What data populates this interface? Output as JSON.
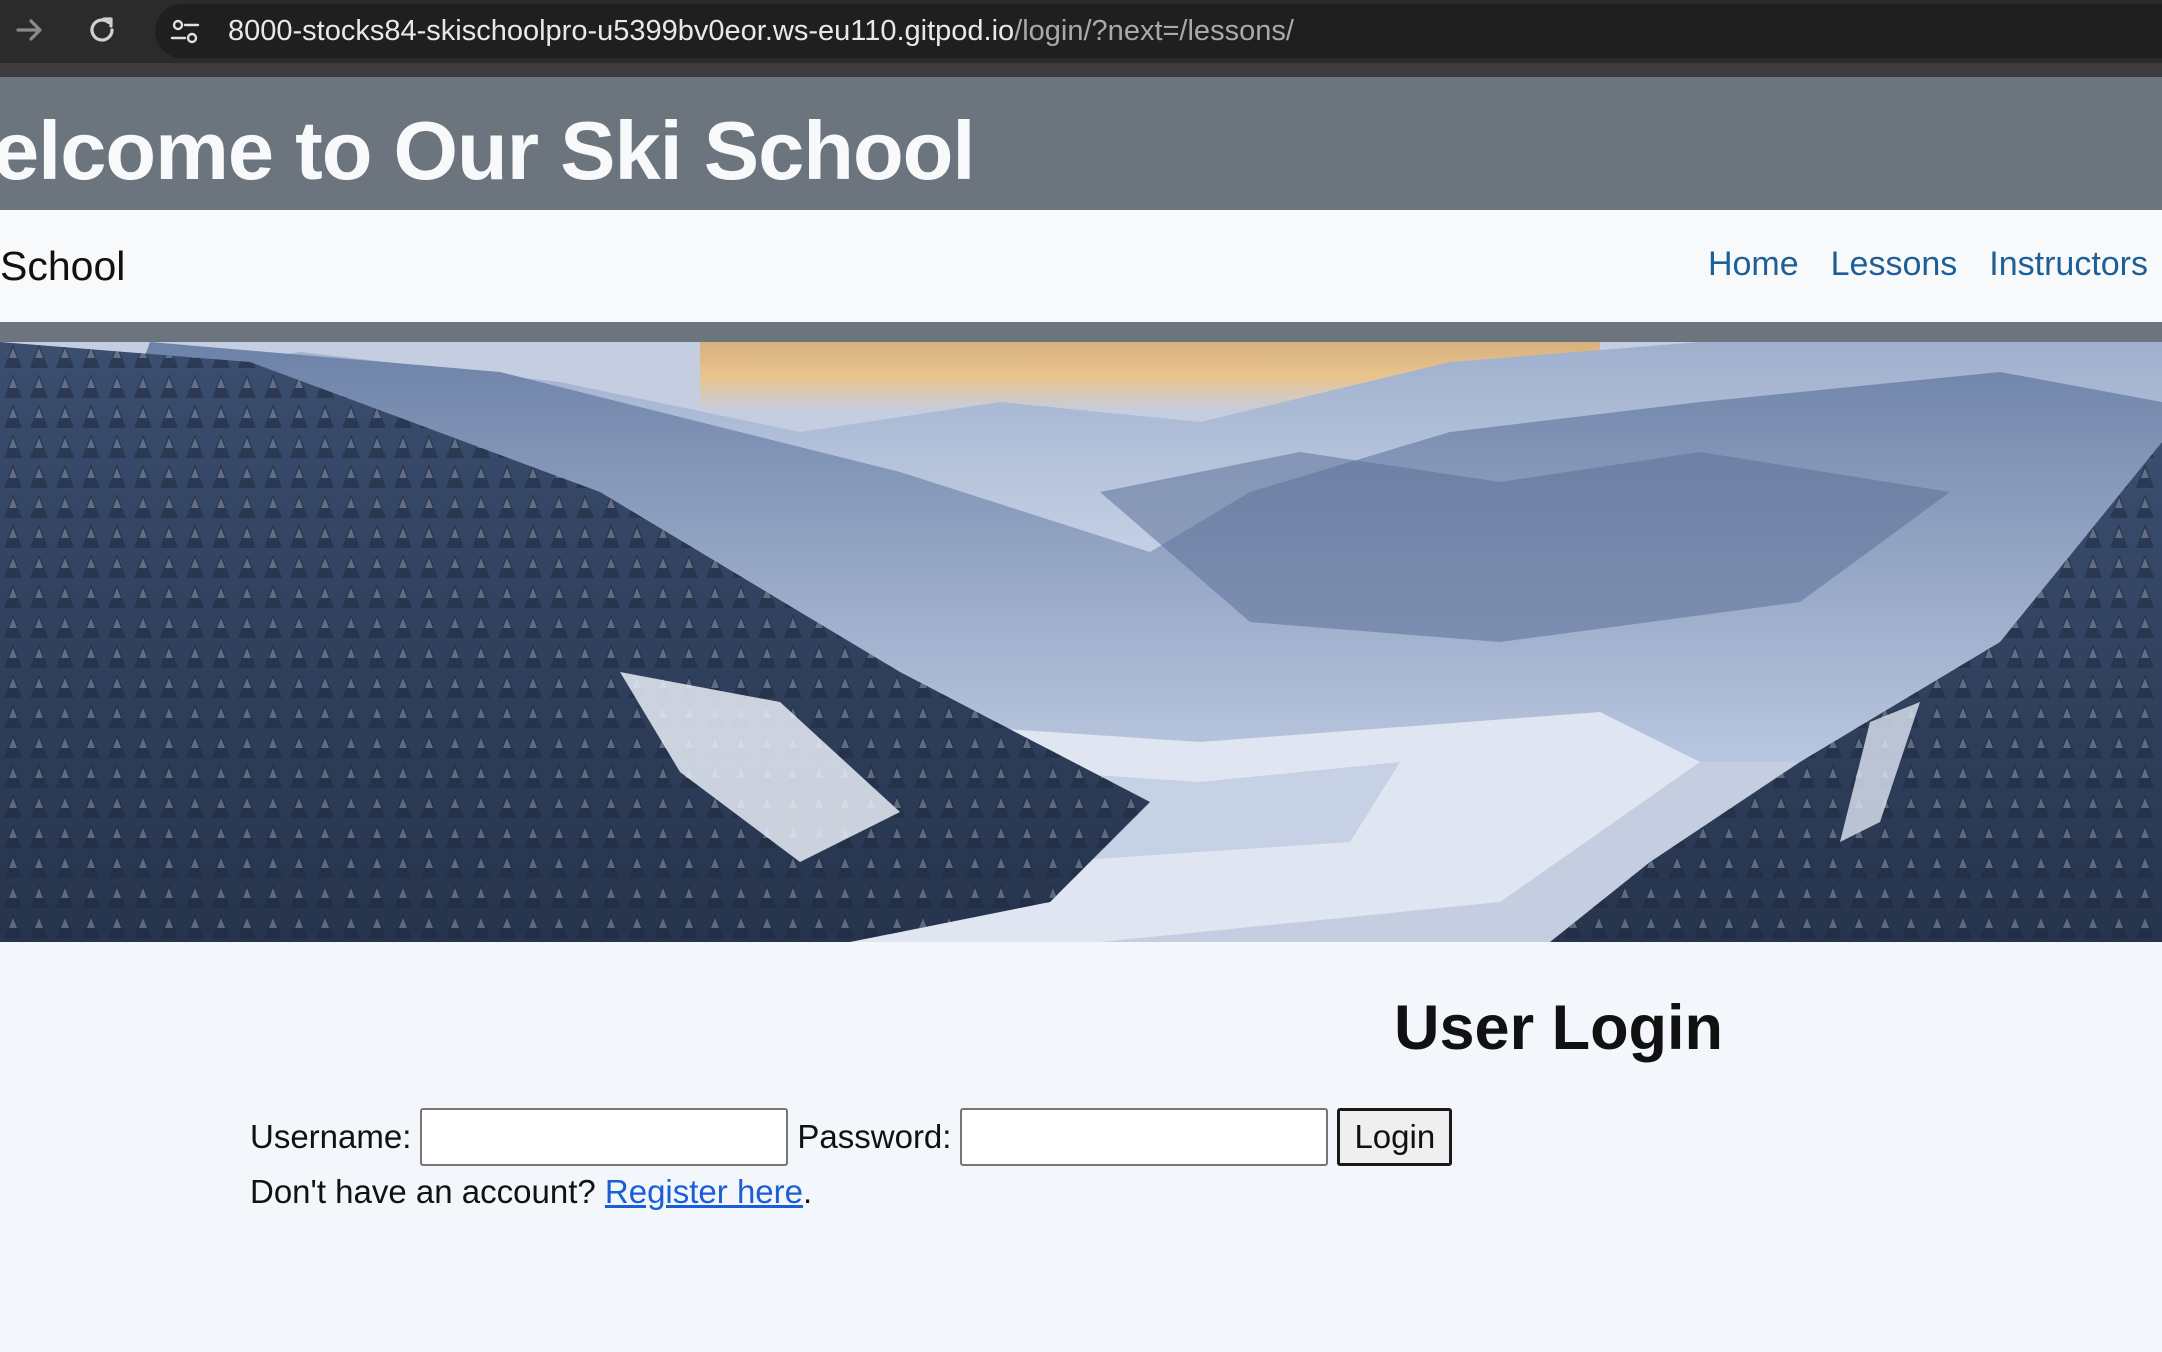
{
  "browser": {
    "url_host": "8000-stocks84-skischoolpro-u5399bv0eor.ws-eu110.gitpod.io",
    "url_path": "/login/?next=/lessons/"
  },
  "header": {
    "welcome_title": "elcome to Our Ski School",
    "brand": "School",
    "nav": [
      {
        "label": "Home"
      },
      {
        "label": "Lessons"
      },
      {
        "label": "Instructors"
      }
    ]
  },
  "login": {
    "title": "User Login",
    "username_label": "Username:",
    "password_label": "Password:",
    "username_value": "",
    "password_value": "",
    "button_label": "Login",
    "register_prompt": "Don't have an account?",
    "register_link": "Register here",
    "register_suffix": "."
  },
  "colors": {
    "header_bg": "#6c757d",
    "navbar_bg": "#f8f9fa",
    "nav_link": "#1d5f96",
    "page_bg": "#f3f6fb",
    "register_link": "#1a5fd6"
  },
  "icons": {
    "forward": "arrow-right-icon",
    "reload": "reload-icon",
    "site_info": "tune-icon",
    "hero": "snowy-mountain-valley-image"
  }
}
